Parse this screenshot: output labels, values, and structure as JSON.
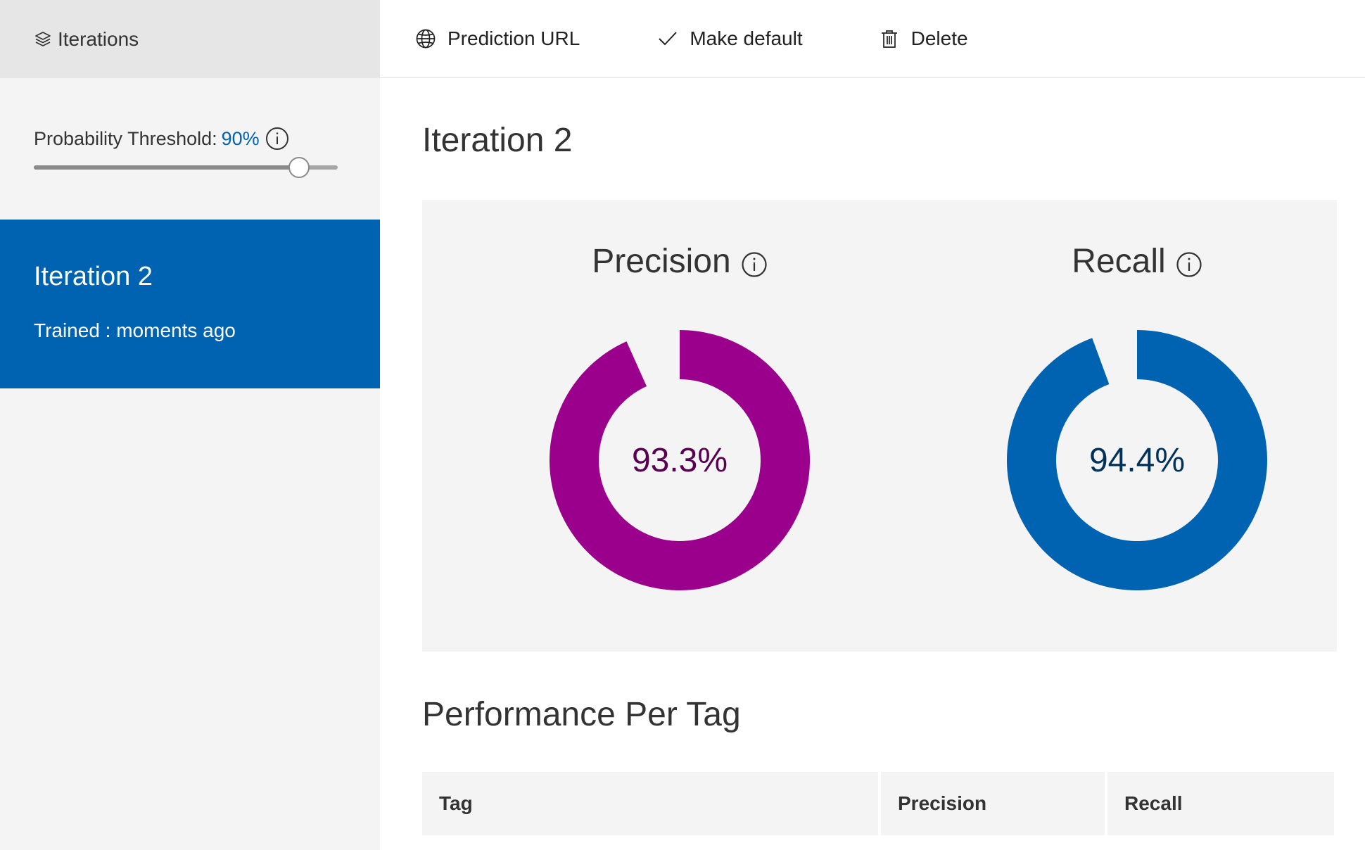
{
  "colors": {
    "accent": "#0063b1",
    "precision": "#9b008d",
    "precision_text": "#5a0052",
    "recall": "#0063b1",
    "recall_text": "#00335c",
    "sidebar_bg": "#f4f4f4",
    "sidebar_header_bg": "#e6e6e6"
  },
  "sidebar": {
    "header_icon": "layers-icon",
    "header_label": "Iterations",
    "threshold": {
      "label": "Probability Threshold:",
      "value": "90%",
      "slider_fraction": 0.9,
      "info_icon": "info-icon"
    },
    "iterations": [
      {
        "name": "Iteration 2",
        "status": "Trained : moments ago",
        "selected": true
      }
    ]
  },
  "toolbar": {
    "prediction_url": {
      "icon": "globe-icon",
      "label": "Prediction URL"
    },
    "make_default": {
      "icon": "checkmark-icon",
      "label": "Make default"
    },
    "delete": {
      "icon": "trash-icon",
      "label": "Delete"
    }
  },
  "main": {
    "title": "Iteration 2",
    "metrics": {
      "precision": {
        "label": "Precision",
        "display": "93.3%",
        "value": 0.933,
        "info_icon": "info-icon"
      },
      "recall": {
        "label": "Recall",
        "display": "94.4%",
        "value": 0.944,
        "info_icon": "info-icon"
      }
    },
    "performance": {
      "title": "Performance Per Tag",
      "columns": [
        "Tag",
        "Precision",
        "Recall"
      ]
    }
  }
}
